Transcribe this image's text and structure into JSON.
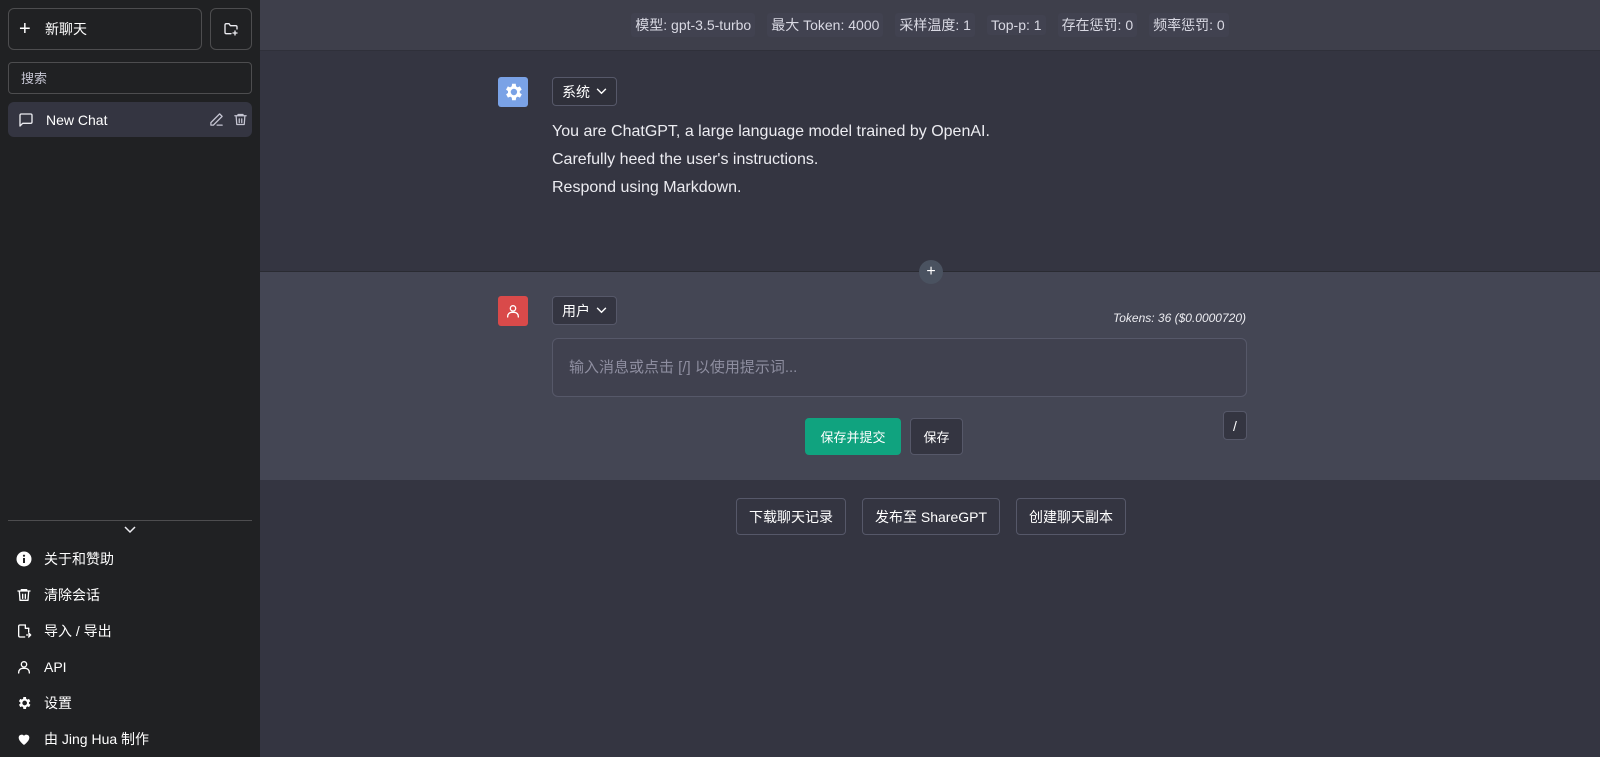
{
  "sidebar": {
    "new_chat_label": "新聊天",
    "search_placeholder": "搜索",
    "chat_items": [
      {
        "label": "New Chat"
      }
    ],
    "menu": [
      {
        "label": "关于和赞助",
        "icon": "info-icon"
      },
      {
        "label": "清除会话",
        "icon": "trash-icon"
      },
      {
        "label": "导入 / 导出",
        "icon": "file-import-icon"
      },
      {
        "label": "API",
        "icon": "person-icon"
      },
      {
        "label": "设置",
        "icon": "gear-icon"
      },
      {
        "label": "由 Jing Hua 制作",
        "icon": "heart-icon"
      }
    ]
  },
  "topbar": {
    "model": "模型: gpt-3.5-turbo",
    "max_token": "最大 Token: 4000",
    "temperature": "采样温度: 1",
    "top_p": "Top-p: 1",
    "presence_penalty": "存在惩罚: 0",
    "frequency_penalty": "频率惩罚: 0"
  },
  "system_message": {
    "role": "系统",
    "lines": [
      "You are ChatGPT, a large language model trained by OpenAI.",
      "Carefully heed the user's instructions.",
      "Respond using Markdown."
    ]
  },
  "user_message": {
    "role": "用户",
    "tokens": "Tokens: 36 ($0.0000720)",
    "placeholder": "输入消息或点击 [/] 以使用提示词...",
    "save_submit": "保存并提交",
    "save": "保存",
    "prompt_shortcut": "/"
  },
  "actions": {
    "download": "下载聊天记录",
    "share": "发布至 ShareGPT",
    "clone": "创建聊天副本"
  },
  "colors": {
    "accent": "#10a37f",
    "sidebar_bg": "#202123",
    "main_bg": "#343541",
    "user_bg": "#444654",
    "system_avatar": "#7aa2e6",
    "user_avatar": "#d94a4a"
  }
}
